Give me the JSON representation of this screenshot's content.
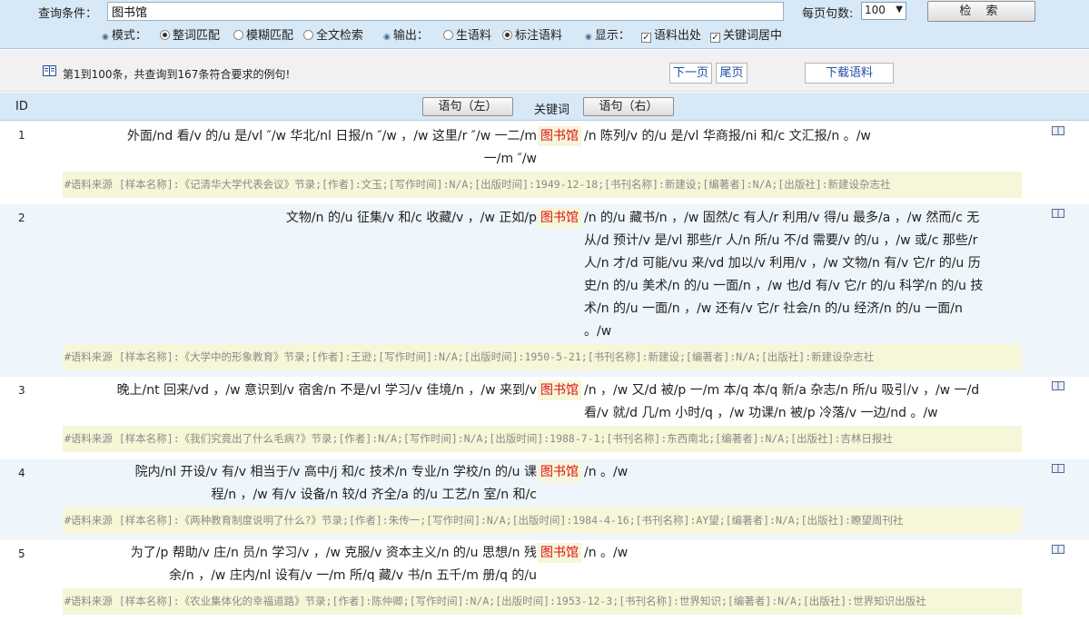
{
  "query": {
    "label": "查询条件：",
    "value": "图书馆",
    "per_page_label": "每页句数:",
    "per_page_value": "100",
    "search_button": "检 索",
    "mode_label": "模式：",
    "mode_options": [
      "整词匹配",
      "模糊匹配",
      "全文检索"
    ],
    "mode_selected": 0,
    "output_label": "输出：",
    "output_options": [
      "生语料",
      "标注语料"
    ],
    "output_selected": 1,
    "display_label": "显示：",
    "display_options": [
      "语料出处",
      "关键词居中"
    ]
  },
  "result_info": {
    "summary": "第1到100条，共查询到167条符合要求的例句!",
    "prev_page": "下一页",
    "last_page": "尾页",
    "download": "下载语料"
  },
  "table_header": {
    "id": "ID",
    "left_sort": "语句（左）",
    "keyword": "关键词",
    "right_sort": "语句（右）"
  },
  "rows": [
    {
      "id": "1",
      "left": "外面/nd 看/v 的/u 是/vl ″/w 华北/nl 日报/n ″/w ，/w 这里/r ″/w 一二/m",
      "keyword": "图书馆",
      "right": [
        "/n 陈列/v 的/u 是/vl 华商报/ni 和/c 文汇报/n 。/w",
        "一/m ″/w"
      ],
      "source": "#语料来源 [样本名称]:《记清华大学代表会议》节录;[作者]:文玉;[写作时间]:N/A;[出版时间]:1949-12-18;[书刊名称]:新建设;[编著者]:N/A;[出版社]:新建设杂志社"
    },
    {
      "id": "2",
      "left": "文物/n 的/u 征集/v 和/c 收藏/v ，/w 正如/p",
      "keyword": "图书馆",
      "right": [
        "/n 的/u 藏书/n ，/w 固然/c 有人/r 利用/v 得/u 最多/a ，/w 然而/c 无",
        "从/d 预计/v 是/vl 那些/r 人/n 所/u 不/d 需要/v 的/u ，/w 或/c 那些/r",
        "人/n 才/d 可能/vu 来/vd 加以/v 利用/v ，/w 文物/n 有/v 它/r 的/u 历",
        "史/n 的/u 美术/n 的/u 一面/n ，/w 也/d 有/v 它/r 的/u 科学/n 的/u 技",
        "术/n 的/u 一面/n ，/w 还有/v 它/r 社会/n 的/u 经济/n 的/u 一面/n",
        "。/w"
      ],
      "source": "#语料来源 [样本名称]:《大学中的形象教育》节录;[作者]:王逊;[写作时间]:N/A;[出版时间]:1950-5-21;[书刊名称]:新建设;[编著者]:N/A;[出版社]:新建设杂志社"
    },
    {
      "id": "3",
      "left": "晚上/nt 回来/vd ，/w 意识到/v 宿舍/n 不是/vl 学习/v 佳境/n ，/w 来到/v",
      "keyword": "图书馆",
      "right": [
        "/n ，/w 又/d 被/p 一/m 本/q 本/q 新/a 杂志/n 所/u 吸引/v ，/w 一/d",
        "看/v 就/d 几/m 小时/q ，/w 功课/n 被/p 冷落/v 一边/nd 。/w"
      ],
      "source": "#语料来源 [样本名称]:《我们究竟出了什么毛病?》节录;[作者]:N/A;[写作时间]:N/A;[出版时间]:1988-7-1;[书刊名称]:东西南北;[编著者]:N/A;[出版社]:吉林日报社"
    },
    {
      "id": "4",
      "left": "院内/nl 开设/v 有/v 相当于/v 高中/j 和/c 技术/n 专业/n 学校/n 的/u 课",
      "left2": "程/n ，/w 有/v 设备/n 较/d 齐全/a 的/u 工艺/n 室/n 和/c",
      "keyword": "图书馆",
      "right": [
        "/n 。/w"
      ],
      "source": "#语料来源 [样本名称]:《两种教育制度说明了什么?》节录;[作者]:朱传一;[写作时间]:N/A;[出版时间]:1984-4-16;[书刊名称]:AY望;[编著者]:N/A;[出版社]:瞭望周刊社"
    },
    {
      "id": "5",
      "left": "为了/p 帮助/v 庄/n 员/n 学习/v ，/w 克服/v 资本主义/n 的/u 思想/n 残",
      "left2": "余/n ，/w 庄内/nl 设有/v 一/m 所/q 藏/v 书/n 五千/m 册/q 的/u",
      "keyword": "图书馆",
      "right": [
        "/n 。/w"
      ],
      "source": "#语料来源 [样本名称]:《农业集体化的幸福道路》节录;[作者]:陈仲卿;[写作时间]:N/A;[出版时间]:1953-12-3;[书刊名称]:世界知识;[编著者]:N/A;[出版社]:世界知识出版社"
    }
  ]
}
